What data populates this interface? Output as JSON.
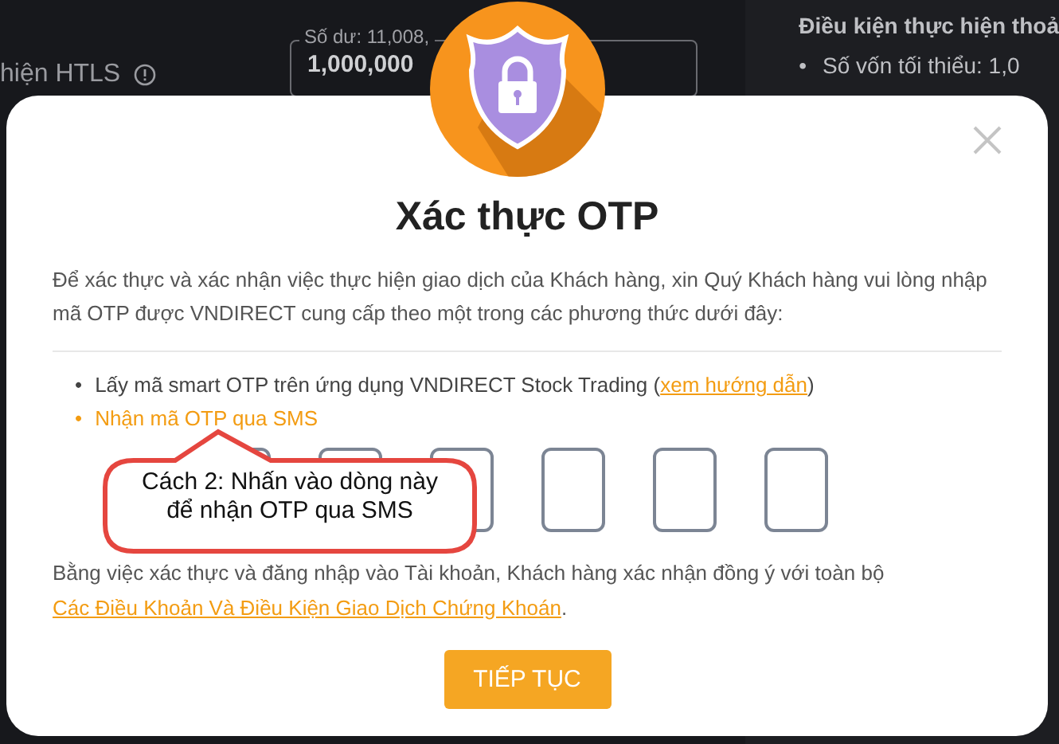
{
  "background": {
    "label": "hiện HTLS",
    "balance_field": {
      "label": "Số dư: 11,008,",
      "value": "1,000,000"
    },
    "side_panel": {
      "title": "Điều kiện thực hiện thoả",
      "items": [
        {
          "marker": "•",
          "text": "Số vốn tối thiểu: 1,0"
        }
      ]
    }
  },
  "dialog": {
    "title": "Xác thực OTP",
    "intro": "Để xác thực và xác nhận việc thực hiện giao dịch của Khách hàng, xin Quý Khách hàng vui lòng nhập mã OTP được VNDIRECT cung cấp theo một trong các phương thức dưới đây:",
    "options": [
      {
        "marker": "•",
        "text": "Lấy mã smart OTP trên ứng dụng VNDIRECT Stock Trading (",
        "link": "xem hướng dẫn",
        "suffix": ")",
        "selected": false
      },
      {
        "marker": "•",
        "text": "Nhận mã OTP qua SMS",
        "selected": true
      }
    ],
    "otp_boxes": [
      {
        "kind": "digit"
      },
      {
        "kind": "digit"
      },
      {
        "kind": "digit"
      },
      {
        "kind": "digit"
      },
      {
        "kind": "digit"
      },
      {
        "kind": "digit"
      }
    ],
    "agreement": "Bằng việc xác thực và đăng nhập vào Tài khoản, Khách hàng xác nhận đồng ý với toàn bộ ",
    "agreement_link": "Các Điều Khoản Và Điều Kiện Giao Dịch Chứng Khoán",
    "agreement_end": ".",
    "button": "TIẾP TỤC"
  },
  "callout": {
    "text": "Cách 2: Nhấn vào dòng này\nđể nhận OTP qua SMS"
  }
}
